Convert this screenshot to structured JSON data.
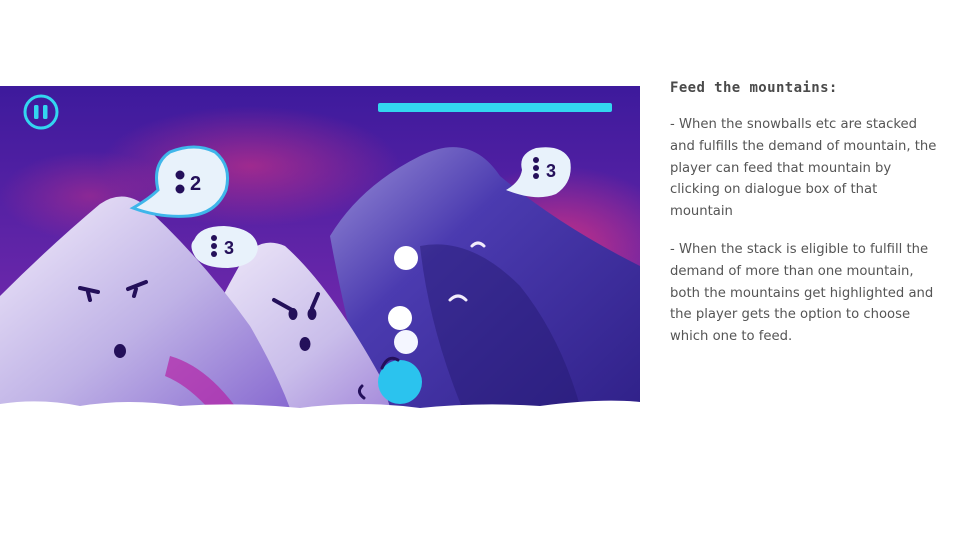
{
  "colors": {
    "sky_top": "#4a1fa6",
    "sky_bottom": "#7a2cae",
    "magenta_haze": "#c02c7c",
    "mountain_light": "#d8cdf0",
    "mountain_dark": "#3c2a9a",
    "snow": "#ffffff",
    "hud_cyan": "#33d6f0",
    "creature_cyan": "#2bc3ee",
    "bubble_fill": "#e8f2fb",
    "bubble_outline": "#3fb6ea",
    "ink": "#24105a",
    "notes_text": "#555555"
  },
  "hud": {
    "pause_icon": "pause-icon",
    "progress_fraction": 1.0
  },
  "bubbles": [
    {
      "count": "2",
      "dots": 2,
      "highlighted": true
    },
    {
      "count": "3",
      "dots": 3,
      "highlighted": false
    },
    {
      "count": "3",
      "dots": 3,
      "highlighted": false
    }
  ],
  "notes": {
    "title": "Feed the mountains:",
    "items": [
      "- When the snowballs etc are stacked and fulfills the demand of mountain, the player can feed that mountain by clicking on dialogue box of that mountain",
      "- When the stack is eligible to fulfill the demand of more than one mountain, both the mountains get highlighted and the player gets the option to choose which one to feed."
    ]
  }
}
